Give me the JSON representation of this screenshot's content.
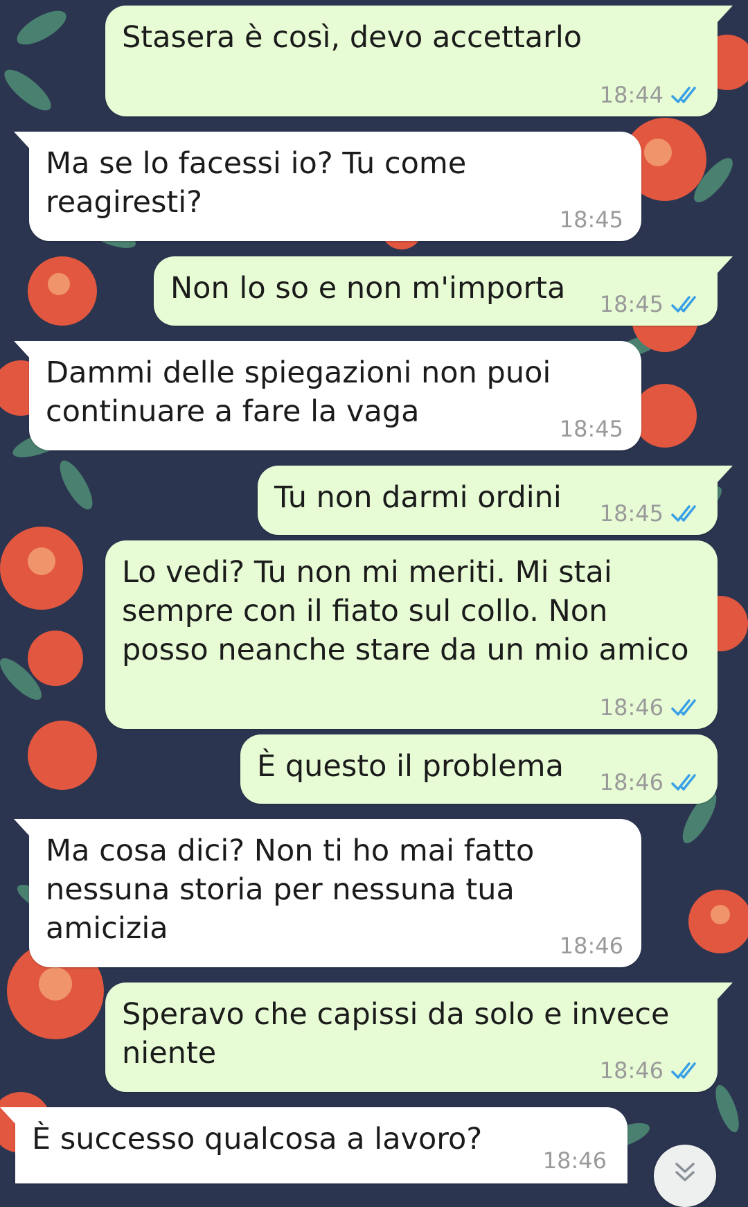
{
  "colors": {
    "outgoing_bubble": "#e7fcd5",
    "incoming_bubble": "#ffffff",
    "read_ticks": "#3aa0e6",
    "timestamp": "#9a9a9a",
    "wallpaper": "#2b3550"
  },
  "messages": [
    {
      "direction": "out",
      "text": "Stasera è così, devo accettarlo",
      "time": "18:44",
      "status": "read-ticks-icon"
    },
    {
      "direction": "in",
      "text": "Ma se lo facessi io? Tu come\nreagiresti?",
      "time": "18:45"
    },
    {
      "direction": "out",
      "text": "Non lo so e non m'importa",
      "time": "18:45",
      "status": "read-ticks-icon"
    },
    {
      "direction": "in",
      "text": "Dammi delle spiegazioni non puoi\ncontinuare a fare la vaga",
      "time": "18:45"
    },
    {
      "direction": "out",
      "text": "Tu non darmi ordini",
      "time": "18:45",
      "status": "read-ticks-icon"
    },
    {
      "direction": "out",
      "text": "Lo vedi? Tu non mi meriti. Mi stai\nsempre con il fiato sul collo. Non\nposso neanche stare da un mio amico",
      "time": "18:46",
      "status": "read-ticks-icon"
    },
    {
      "direction": "out",
      "text": "È questo il problema",
      "time": "18:46",
      "status": "read-ticks-icon"
    },
    {
      "direction": "in",
      "text": "Ma cosa dici? Non ti ho mai fatto\nnessuna storia per nessuna tua\namicizia",
      "time": "18:46"
    },
    {
      "direction": "out",
      "text": "Speravo che capissi da solo e invece\nniente",
      "time": "18:46",
      "status": "read-ticks-icon"
    },
    {
      "direction": "in",
      "text": "È successo qualcosa a lavoro?",
      "time": "18:46"
    }
  ],
  "scroll_button": {
    "icon": "double-chevron-down-icon"
  }
}
